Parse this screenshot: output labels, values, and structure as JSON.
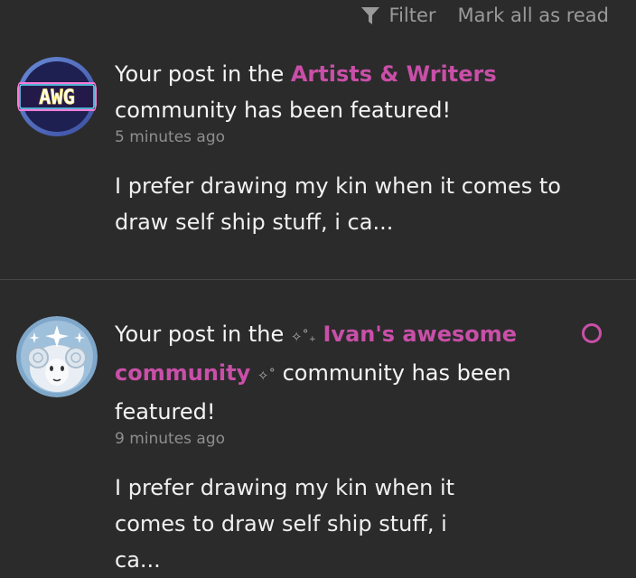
{
  "topbar": {
    "filter_label": "Filter",
    "filter_icon": "funnel-icon",
    "mark_all_label": "Mark all as read"
  },
  "colors": {
    "background": "#2b2b2b",
    "accent": "#c94fa8",
    "muted": "#8f8f8f"
  },
  "notifications": [
    {
      "avatar": "awg-community-logo",
      "prefix": "Your post in the ",
      "community": "Artists & Writers",
      "suffix": "community has been featured!",
      "time": "5 minutes ago",
      "excerpt": "I prefer drawing my kin when it comes to draw self ship stuff, i ca..."
    },
    {
      "avatar": "sheep-avatar",
      "prefix": "Your post in the ",
      "community_sparkle_left": "✧˚₊",
      "community": "Ivan's awesome community",
      "community_sparkle_right": "✧˚",
      "suffix": " community has been featured!",
      "time": "9 minutes ago",
      "excerpt": "I prefer drawing my kin when it comes to draw self ship stuff, i ca...",
      "unread": true
    }
  ]
}
